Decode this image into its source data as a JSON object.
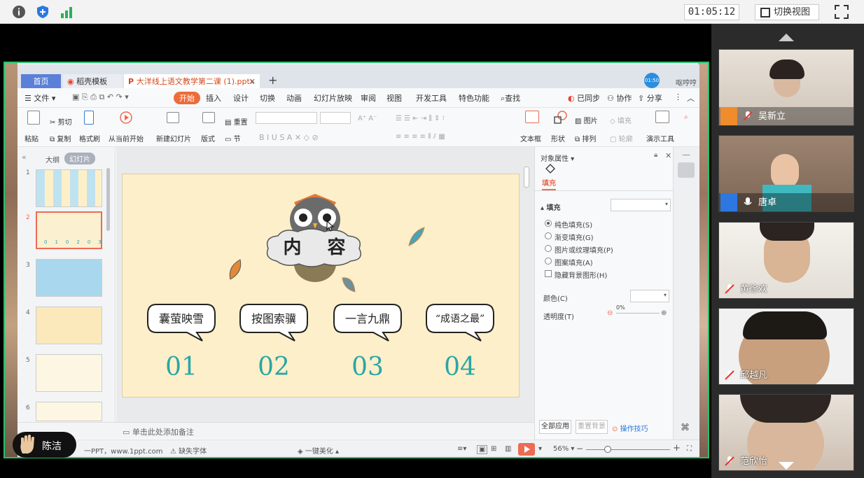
{
  "meeting": {
    "timer": "01:05:12",
    "switch_view_label": "切换视图"
  },
  "wps": {
    "tabs": {
      "home": "首页",
      "templates": "稻壳模板",
      "document": "大洋线上语文教学第二课 (1).pptx"
    },
    "user_label": "呕哼哼",
    "avatar_time": "01:50",
    "menu": {
      "file": "文件",
      "start": "开始",
      "insert": "插入",
      "design": "设计",
      "transition": "切换",
      "animation": "动画",
      "slideshow": "幻灯片放映",
      "review": "审阅",
      "view": "视图",
      "developer": "开发工具",
      "special": "特色功能",
      "find": "查找",
      "sync": "已同步",
      "collab": "协作",
      "share": "分享"
    },
    "ribbon": {
      "paste": "粘贴",
      "cut": "剪切",
      "copy": "复制",
      "format_painter": "格式刷",
      "from_start": "从当前开始",
      "new_slide": "新建幻灯片",
      "layout": "版式",
      "reset": "重置",
      "section": "节",
      "textbox": "文本框",
      "shape": "形状",
      "picture": "图片",
      "arrange": "排列",
      "fill": "填充",
      "outline": "轮廓",
      "presentation_tool": "演示工具"
    },
    "thumbs": {
      "outline": "大纲",
      "slides": "幻灯片",
      "numbers": [
        "1",
        "2",
        "3",
        "4",
        "5",
        "6"
      ]
    },
    "slide": {
      "title": "内 容",
      "items": [
        {
          "label": "囊萤映雪",
          "num": "01"
        },
        {
          "label": "按图索骥",
          "num": "02"
        },
        {
          "label": "一言九鼎",
          "num": "03"
        },
        {
          "label": "“成语之最”",
          "num": "04"
        }
      ]
    },
    "notes_placeholder": "单击此处添加备注",
    "props": {
      "header": "对象属性",
      "fill_tab": "填充",
      "fill_section": "填充",
      "options": [
        "纯色填充(S)",
        "渐变填充(G)",
        "图片或纹理填充(P)",
        "图案填充(A)"
      ],
      "hide_bg": "隐藏背景图形(H)",
      "color": "颜色(C)",
      "transparency": "透明度(T)",
      "transparency_value": "0%",
      "apply_all": "全部应用",
      "reset_bg": "重置背景",
      "tips": "操作技巧"
    },
    "status": {
      "source": "一PPT，www.1ppt.com",
      "missing_font": "缺失字体",
      "beautify": "一键美化",
      "zoom": "56%"
    }
  },
  "raised_hand_name": "陈洁",
  "participants": [
    {
      "name": "吴新立",
      "muted": true
    },
    {
      "name": "唐卓",
      "muted": false
    },
    {
      "name": "黄徐欢",
      "muted": true
    },
    {
      "name": "邱越凡",
      "muted": true
    },
    {
      "name": "范欣怡",
      "muted": true
    }
  ],
  "colors": {
    "accent_green": "#25c26a",
    "wps_orange": "#ed6c3a",
    "slide_number_teal": "#2aa6a6",
    "slide_bg": "#fdefc9"
  }
}
